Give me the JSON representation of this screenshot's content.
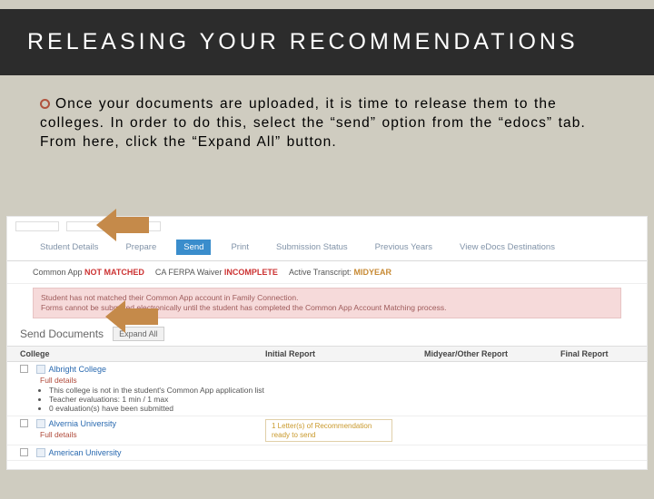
{
  "title": "RELEASING YOUR RECOMMENDATIONS",
  "bullet": "Once your documents are uploaded, it is time to release them to the colleges.  In order to do this, select the “send” option from the “edocs” tab.  From here, click the “Expand All” button.",
  "tabs": {
    "items": [
      "Student Details",
      "Prepare",
      "Send",
      "Print",
      "Submission Status",
      "Previous Years",
      "View eDocs Destinations"
    ],
    "active": "Send"
  },
  "status": {
    "common_app_label": "Common App",
    "common_app_value": "NOT MATCHED",
    "ferpa_label": "CA FERPA Waiver",
    "ferpa_value": "INCOMPLETE",
    "transcript_label": "Active Transcript:",
    "transcript_value": "MIDYEAR"
  },
  "warning": {
    "line1": "Student has not matched their Common App account in Family Connection.",
    "line2": "Forms cannot be submitted electronically until the student has completed the Common App Account Matching process."
  },
  "send_section": {
    "heading": "Send Documents",
    "expand": "Expand All"
  },
  "cols": [
    "College",
    "Initial Report",
    "Midyear/Other Report",
    "Final Report"
  ],
  "rows": [
    {
      "name": "Albright College",
      "full_details": "Full details",
      "sub": [
        "This college is not in the student's Common App application list",
        "Teacher evaluations: 1 min / 1 max",
        "0 evaluation(s) have been submitted"
      ]
    },
    {
      "name": "Alvernia University",
      "full_details": "Full details",
      "rec": {
        "line1": "1 Letter(s) of Recommendation",
        "line2": "ready to send"
      }
    },
    {
      "name": "American University"
    }
  ]
}
